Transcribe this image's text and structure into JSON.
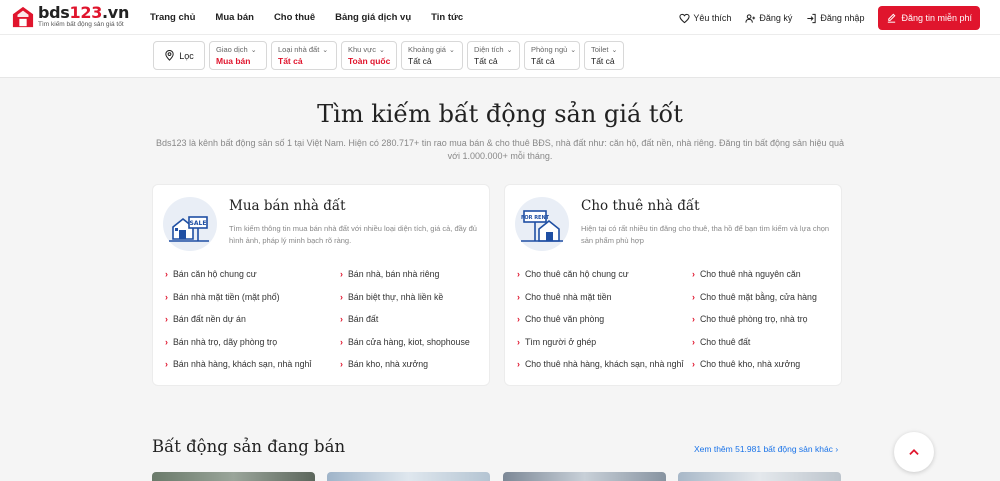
{
  "header": {
    "logo_prefix": "bds",
    "logo_num": "123",
    "logo_suffix": ".vn",
    "logo_tagline": "Tìm kiếm bất động sản giá tốt",
    "nav": [
      "Trang chủ",
      "Mua bán",
      "Cho thuê",
      "Bảng giá dịch vụ",
      "Tin tức"
    ],
    "favorite": "Yêu thích",
    "register": "Đăng ký",
    "login": "Đăng nhập",
    "post": "Đăng tin miễn phí"
  },
  "filters": {
    "location": "Lọc",
    "items": [
      {
        "label": "Giao dịch",
        "value": "Mua bán",
        "highlight": true
      },
      {
        "label": "Loại nhà đất",
        "value": "Tất cả",
        "highlight": true
      },
      {
        "label": "Khu vực",
        "value": "Toàn quốc",
        "highlight": true
      },
      {
        "label": "Khoảng giá",
        "value": "Tất cả",
        "highlight": false
      },
      {
        "label": "Diện tích",
        "value": "Tất cả",
        "highlight": false
      },
      {
        "label": "Phòng ngủ",
        "value": "Tất cả",
        "highlight": false
      },
      {
        "label": "Toilet",
        "value": "Tất cả",
        "highlight": false
      }
    ]
  },
  "hero": {
    "title": "Tìm kiếm bất động sản giá tốt",
    "subtitle": "Bds123 là kênh bất động sản số 1 tại Việt Nam. Hiện có 280.717+ tin rao mua bán & cho thuê BĐS, nhà đất như: căn hộ, đất nền, nhà riêng. Đăng tin bất động sản hiệu quả với 1.000.000+ mỗi tháng."
  },
  "cards": {
    "sale": {
      "title": "Mua bán nhà đất",
      "desc": "Tìm kiếm thông tin mua bán nhà đất với nhiều loại diện tích, giá cả, đầy đủ hình ảnh, pháp lý minh bạch rõ ràng.",
      "sign": "SALE",
      "links": [
        "Bán căn hộ chung cư",
        "Bán nhà, bán nhà riêng",
        "Bán nhà mặt tiền (mặt phố)",
        "Bán biệt thự, nhà liền kề",
        "Bán đất nền dự án",
        "Bán đất",
        "Bán nhà trọ, dãy phòng trọ",
        "Bán cửa hàng, kiot, shophouse",
        "Bán nhà hàng, khách sạn, nhà nghỉ",
        "Bán kho, nhà xưởng"
      ]
    },
    "rent": {
      "title": "Cho thuê nhà đất",
      "desc": "Hiện tại có rất nhiều tin đăng cho thuê, tha hồ để bạn tìm kiếm và lựa chọn sản phẩm phù hợp",
      "sign": "FOR RENT",
      "links": [
        "Cho thuê căn hộ chung cư",
        "Cho thuê nhà nguyên căn",
        "Cho thuê nhà mặt tiền",
        "Cho thuê mặt bằng, cửa hàng",
        "Cho thuê văn phòng",
        "Cho thuê phòng trọ, nhà trọ",
        "Tìm người ở ghép",
        "Cho thuê đất",
        "Cho thuê nhà hàng, khách sạn, nhà nghỉ",
        "Cho thuê kho, nhà xưởng"
      ]
    }
  },
  "section": {
    "title": "Bất động sản đang bán",
    "more": "Xem thêm 51.981 bất động sản khác"
  },
  "icons": {
    "favorite": "heart-icon",
    "register": "user-plus-icon",
    "login": "login-icon",
    "post": "edit-icon",
    "location": "map-pin-icon",
    "scroll_top": "chevron-up-icon"
  },
  "colors": {
    "brand": "#e0152d",
    "link": "#1a73e8",
    "icon_blue": "#1f4fa3"
  }
}
